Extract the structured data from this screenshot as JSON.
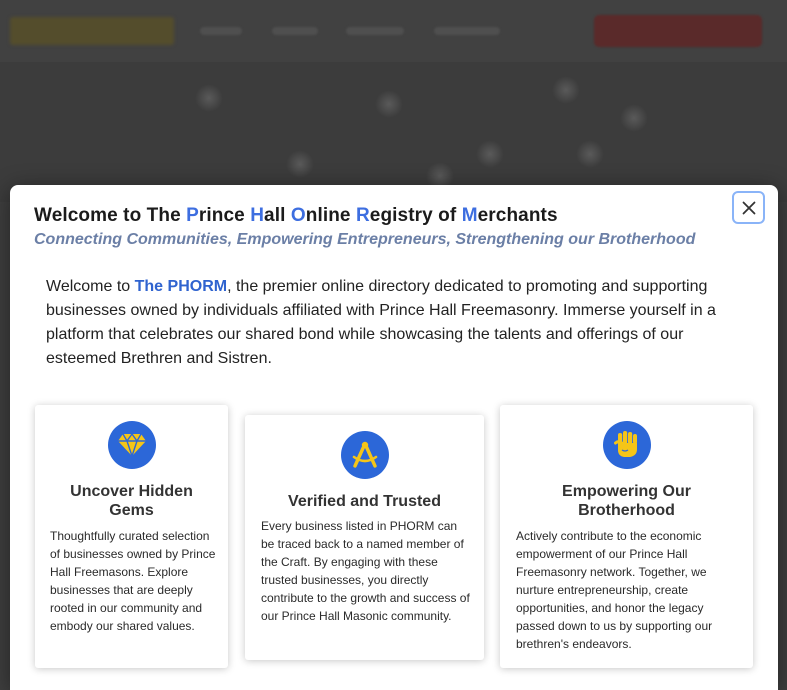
{
  "modal": {
    "title_parts": {
      "t1": "Welcome to The ",
      "p": "P",
      "rince": "rince ",
      "h": "H",
      "all": "all ",
      "o": "O",
      "nline": "nline ",
      "r": "R",
      "egistry": "egistry of ",
      "m": "M",
      "erchants": "erchants"
    },
    "subtitle": "Connecting Communities, Empowering Entrepreneurs, Strengthening our Brotherhood",
    "intro_prefix": "Welcome to ",
    "intro_brand": "The PHORM",
    "intro_rest": ", the premier online directory dedicated to promoting and supporting businesses owned by individuals affiliated with Prince Hall Freemasonry. Immerse yourself in a platform that celebrates our shared bond while showcasing the talents and offerings of our esteemed Brethren and Sistren.",
    "close_icon": "close-icon",
    "accent_color": "#2c67d8",
    "icon_glyph_color": "#f5c518"
  },
  "cards": [
    {
      "icon": "gem-icon",
      "title": "Uncover Hidden Gems",
      "body": "Thoughtfully curated selection of businesses owned by Prince Hall Freemasons. Explore businesses that are deeply rooted in our community and embody our shared values."
    },
    {
      "icon": "compass-icon",
      "title": "Verified and Trusted",
      "body": "Every business listed in PHORM can be traced back to a named member of the Craft. By engaging with these trusted businesses, you directly contribute to the growth and success of our Prince Hall Masonic community."
    },
    {
      "icon": "raised-fist-icon",
      "title": "Empowering Our Brotherhood",
      "body": "Actively contribute to the economic empowerment of our Prince Hall Freemasonry network. Together, we nurture entrepreneurship, create opportunities, and honor the legacy passed down to us by supporting our brethren's endeavors."
    }
  ]
}
